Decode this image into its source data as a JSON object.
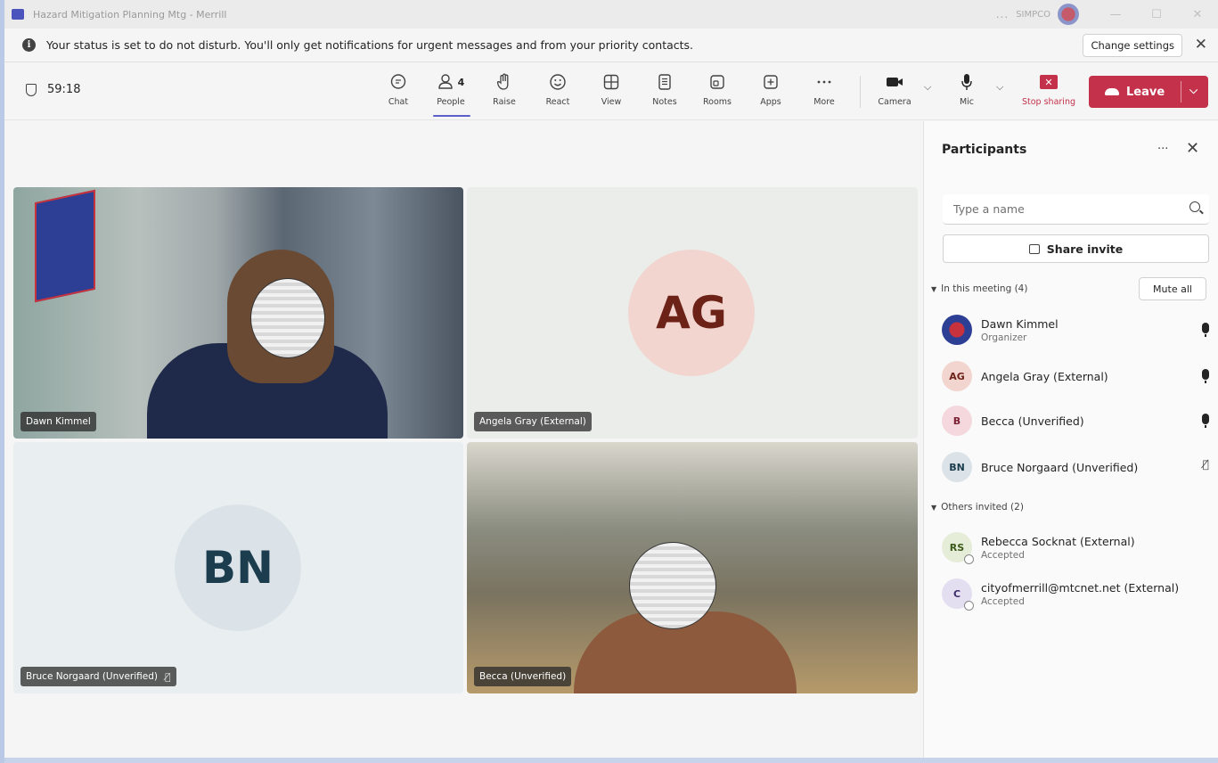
{
  "window": {
    "title": "Hazard Mitigation Planning Mtg - Merrill",
    "org": "SIMPCO",
    "more": "...",
    "minimize": "—",
    "maximize": "☐",
    "close": "✕"
  },
  "notification": {
    "message": "Your status is set to do not disturb. You'll only get notifications for urgent messages and from your priority contacts.",
    "change_settings": "Change settings",
    "close": "✕"
  },
  "toolbar": {
    "timer": "59:18",
    "people_count": "4",
    "items": {
      "chat": "Chat",
      "people": "People",
      "raise": "Raise",
      "react": "React",
      "view": "View",
      "notes": "Notes",
      "rooms": "Rooms",
      "apps": "Apps",
      "more": "More",
      "camera": "Camera",
      "mic": "Mic",
      "stop_sharing": "Stop sharing"
    },
    "leave": "Leave"
  },
  "tiles": [
    {
      "name": "Dawn Kimmel"
    },
    {
      "name": "Angela Gray (External)",
      "initials": "AG"
    },
    {
      "name": "Bruce Norgaard (Unverified)",
      "initials": "BN"
    },
    {
      "name": "Becca (Unverified)"
    }
  ],
  "panel": {
    "title": "Participants",
    "more": "···",
    "close": "✕",
    "search_placeholder": "Type a name",
    "share_invite": "Share invite",
    "in_meeting_header": "In this meeting (4)",
    "mute_all": "Mute all",
    "in_meeting": [
      {
        "name": "Dawn Kimmel",
        "role": "Organizer",
        "initials": ""
      },
      {
        "name": "Angela Gray (External)",
        "role": "",
        "initials": "AG"
      },
      {
        "name": "Becca (Unverified)",
        "role": "",
        "initials": "B"
      },
      {
        "name": "Bruce Norgaard (Unverified)",
        "role": "",
        "initials": "BN"
      }
    ],
    "others_header": "Others invited (2)",
    "others": [
      {
        "name": "Rebecca Socknat (External)",
        "role": "Accepted",
        "initials": "RS"
      },
      {
        "name": "cityofmerrill@mtcnet.net (External)",
        "role": "Accepted",
        "initials": "C"
      }
    ]
  },
  "colors": {
    "accent": "#5b5fc7",
    "leave": "#c4314b",
    "ag_avatar": "#f2d5cf",
    "bn_avatar": "#dbe3e8"
  }
}
